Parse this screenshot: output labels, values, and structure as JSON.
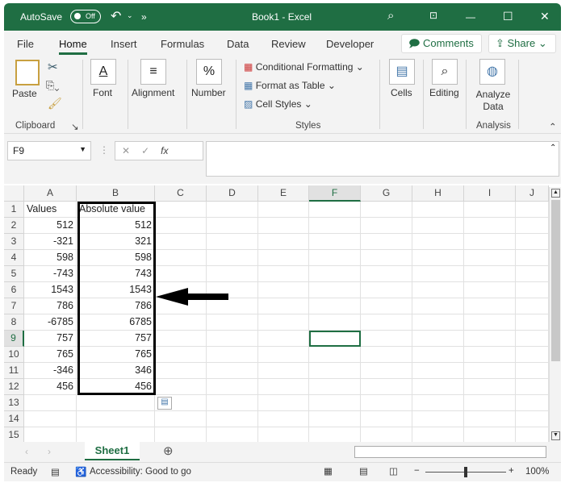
{
  "titlebar": {
    "autosave": "AutoSave",
    "toggle": "Off",
    "title": "Book1 - Excel",
    "more": "»"
  },
  "tabs": [
    "File",
    "Home",
    "Insert",
    "Formulas",
    "Data",
    "Review",
    "Developer"
  ],
  "comments": "Comments",
  "share": "Share",
  "ribbon": {
    "paste": "Paste",
    "clipboard": "Clipboard",
    "font": "Font",
    "alignment": "Alignment",
    "number": "Number",
    "conditional": "Conditional Formatting",
    "format_table": "Format as Table",
    "cell_styles": "Cell Styles",
    "styles": "Styles",
    "cells": "Cells",
    "editing": "Editing",
    "analyze": "Analyze Data",
    "analysis": "Analysis"
  },
  "formula_bar": {
    "name_box": "F9",
    "fx": "fx",
    "value": ""
  },
  "columns": [
    "A",
    "B",
    "C",
    "D",
    "E",
    "F",
    "G",
    "H",
    "I",
    "J"
  ],
  "rows": [
    "1",
    "2",
    "3",
    "4",
    "5",
    "6",
    "7",
    "8",
    "9",
    "10",
    "11",
    "12",
    "13",
    "14",
    "15"
  ],
  "headers": {
    "a": "Values",
    "b": "Absolute value"
  },
  "values": [
    512,
    -321,
    598,
    -743,
    1543,
    786,
    -6785,
    757,
    765,
    -346,
    456
  ],
  "absolute": [
    512,
    321,
    598,
    743,
    1543,
    786,
    6785,
    757,
    765,
    346,
    456
  ],
  "selected_cell": "F9",
  "sheet_tab": "Sheet1",
  "status": {
    "ready": "Ready",
    "accessibility": "Accessibility: Good to go",
    "zoom": "100%"
  }
}
